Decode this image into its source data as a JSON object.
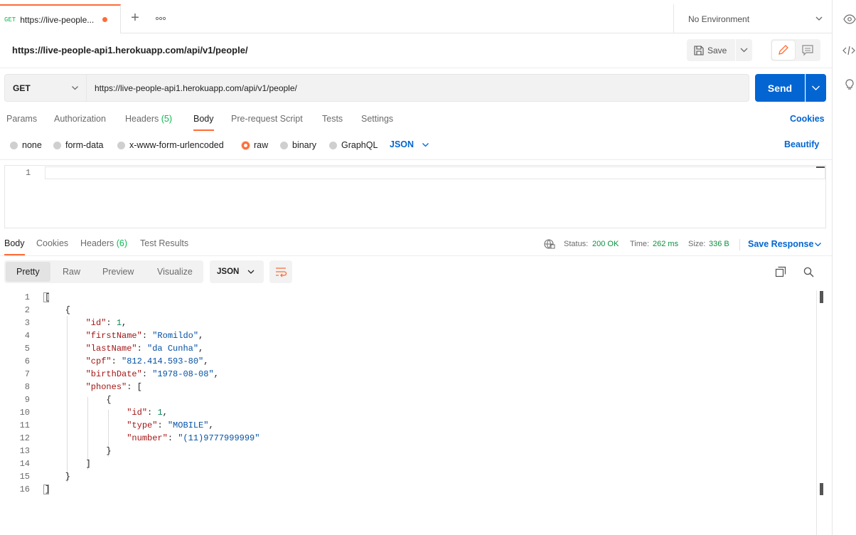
{
  "tabbar": {
    "tab": {
      "method": "GET",
      "title": "https://live-people..."
    },
    "env": "No Environment"
  },
  "request": {
    "name": "https://live-people-api1.herokuapp.com/api/v1/people/",
    "save_label": "Save",
    "method": "GET",
    "url": "https://live-people-api1.herokuapp.com/api/v1/people/",
    "send_label": "Send"
  },
  "request_tabs": {
    "params": "Params",
    "authorization": "Authorization",
    "headers": "Headers",
    "headers_count": "(5)",
    "body": "Body",
    "prerequest": "Pre-request Script",
    "tests": "Tests",
    "settings": "Settings",
    "cookies": "Cookies"
  },
  "body_types": {
    "none": "none",
    "form_data": "form-data",
    "urlencoded": "x-www-form-urlencoded",
    "raw": "raw",
    "binary": "binary",
    "graphql": "GraphQL",
    "selected": "raw",
    "format": "JSON",
    "beautify": "Beautify"
  },
  "request_editor": {
    "line": "1"
  },
  "response_tabs": {
    "body": "Body",
    "cookies": "Cookies",
    "headers": "Headers",
    "headers_count": "(6)",
    "test_results": "Test Results"
  },
  "response_status": {
    "status_label": "Status:",
    "status_value": "200 OK",
    "time_label": "Time:",
    "time_value": "262 ms",
    "size_label": "Size:",
    "size_value": "336 B",
    "save_response": "Save Response"
  },
  "response_view": {
    "pretty": "Pretty",
    "raw": "Raw",
    "preview": "Preview",
    "visualize": "Visualize",
    "format": "JSON"
  },
  "response_body": {
    "line_numbers": [
      "1",
      "2",
      "3",
      "4",
      "5",
      "6",
      "7",
      "8",
      "9",
      "10",
      "11",
      "12",
      "13",
      "14",
      "15",
      "16"
    ],
    "id_key": "\"id\"",
    "id_val": "1",
    "firstName_key": "\"firstName\"",
    "firstName_val": "\"Romildo\"",
    "lastName_key": "\"lastName\"",
    "lastName_val": "\"da Cunha\"",
    "cpf_key": "\"cpf\"",
    "cpf_val": "\"812.414.593-80\"",
    "birthDate_key": "\"birthDate\"",
    "birthDate_val": "\"1978-08-08\"",
    "phones_key": "\"phones\"",
    "phone_id_key": "\"id\"",
    "phone_id_val": "1",
    "phone_type_key": "\"type\"",
    "phone_type_val": "\"MOBILE\"",
    "phone_number_key": "\"number\"",
    "phone_number_val": "\"(11)9777999999\""
  },
  "colors": {
    "accent": "#ff6c37",
    "primary": "#0265d2",
    "success": "#0cbb52"
  }
}
